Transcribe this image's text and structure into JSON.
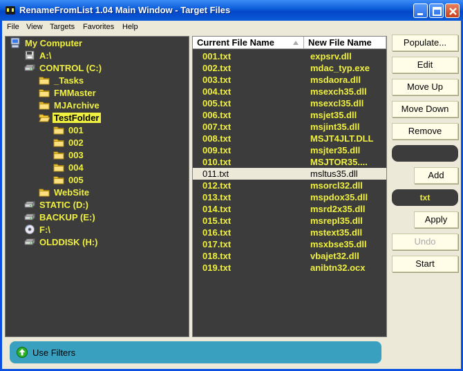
{
  "window": {
    "title": "RenameFromList 1.04 Main Window - Target Files"
  },
  "menu": [
    "File",
    "View",
    "Targets",
    "Favorites",
    "Help"
  ],
  "tree": [
    {
      "label": "My Computer",
      "icon": "computer-icon",
      "level": 0
    },
    {
      "label": "A:\\",
      "icon": "floppy-drive-icon",
      "level": 1
    },
    {
      "label": "CONTROL (C:)",
      "icon": "hard-drive-icon",
      "level": 1
    },
    {
      "label": "_Tasks",
      "icon": "folder-icon",
      "level": 2
    },
    {
      "label": "FMMaster",
      "icon": "folder-icon",
      "level": 2
    },
    {
      "label": "MJArchive",
      "icon": "folder-icon",
      "level": 2
    },
    {
      "label": "TestFolder",
      "icon": "folder-open-icon",
      "level": 2,
      "selected": true
    },
    {
      "label": "001",
      "icon": "folder-icon",
      "level": 3
    },
    {
      "label": "002",
      "icon": "folder-icon",
      "level": 3
    },
    {
      "label": "003",
      "icon": "folder-icon",
      "level": 3
    },
    {
      "label": "004",
      "icon": "folder-icon",
      "level": 3
    },
    {
      "label": "005",
      "icon": "folder-icon",
      "level": 3
    },
    {
      "label": "WebSite",
      "icon": "folder-icon",
      "level": 2
    },
    {
      "label": "STATIC (D:)",
      "icon": "hard-drive-icon",
      "level": 1
    },
    {
      "label": "BACKUP (E:)",
      "icon": "hard-drive-icon",
      "level": 1
    },
    {
      "label": "F:\\",
      "icon": "cd-drive-icon",
      "level": 1
    },
    {
      "label": "OLDDISK (H:)",
      "icon": "hard-drive-icon",
      "level": 1
    }
  ],
  "list": {
    "columns": [
      "Current File Name",
      "New File Name"
    ],
    "rows": [
      [
        "001.txt",
        "expsrv.dll"
      ],
      [
        "002.txt",
        "mdac_typ.exe"
      ],
      [
        "003.txt",
        "msdaora.dll"
      ],
      [
        "004.txt",
        "msexch35.dll"
      ],
      [
        "005.txt",
        "msexcl35.dll"
      ],
      [
        "006.txt",
        "msjet35.dll"
      ],
      [
        "007.txt",
        "msjint35.dll"
      ],
      [
        "008.txt",
        "MSJT4JLT.DLL"
      ],
      [
        "009.txt",
        "msjter35.dll"
      ],
      [
        "010.txt",
        "MSJTOR35...."
      ],
      [
        "011.txt",
        "msltus35.dll"
      ],
      [
        "012.txt",
        "msorcl32.dll"
      ],
      [
        "013.txt",
        "mspdox35.dll"
      ],
      [
        "014.txt",
        "msrd2x35.dll"
      ],
      [
        "015.txt",
        "msrepl35.dll"
      ],
      [
        "016.txt",
        "mstext35.dll"
      ],
      [
        "017.txt",
        "msxbse35.dll"
      ],
      [
        "018.txt",
        "vbajet32.dll"
      ],
      [
        "019.txt",
        "anibtn32.ocx"
      ]
    ],
    "selected_row": 10
  },
  "buttons": {
    "populate": "Populate...",
    "edit": "Edit",
    "move_up": "Move Up",
    "move_down": "Move Down",
    "remove": "Remove",
    "add": "Add",
    "apply": "Apply",
    "undo": "Undo",
    "start": "Start"
  },
  "inputs": {
    "add_value": "",
    "extension_value": "txt"
  },
  "status": {
    "label": "Use Filters"
  },
  "colors": {
    "accent_text": "#f0f040",
    "panel_bg": "#3c3c3c",
    "titlebar": "#0a5ad8"
  }
}
